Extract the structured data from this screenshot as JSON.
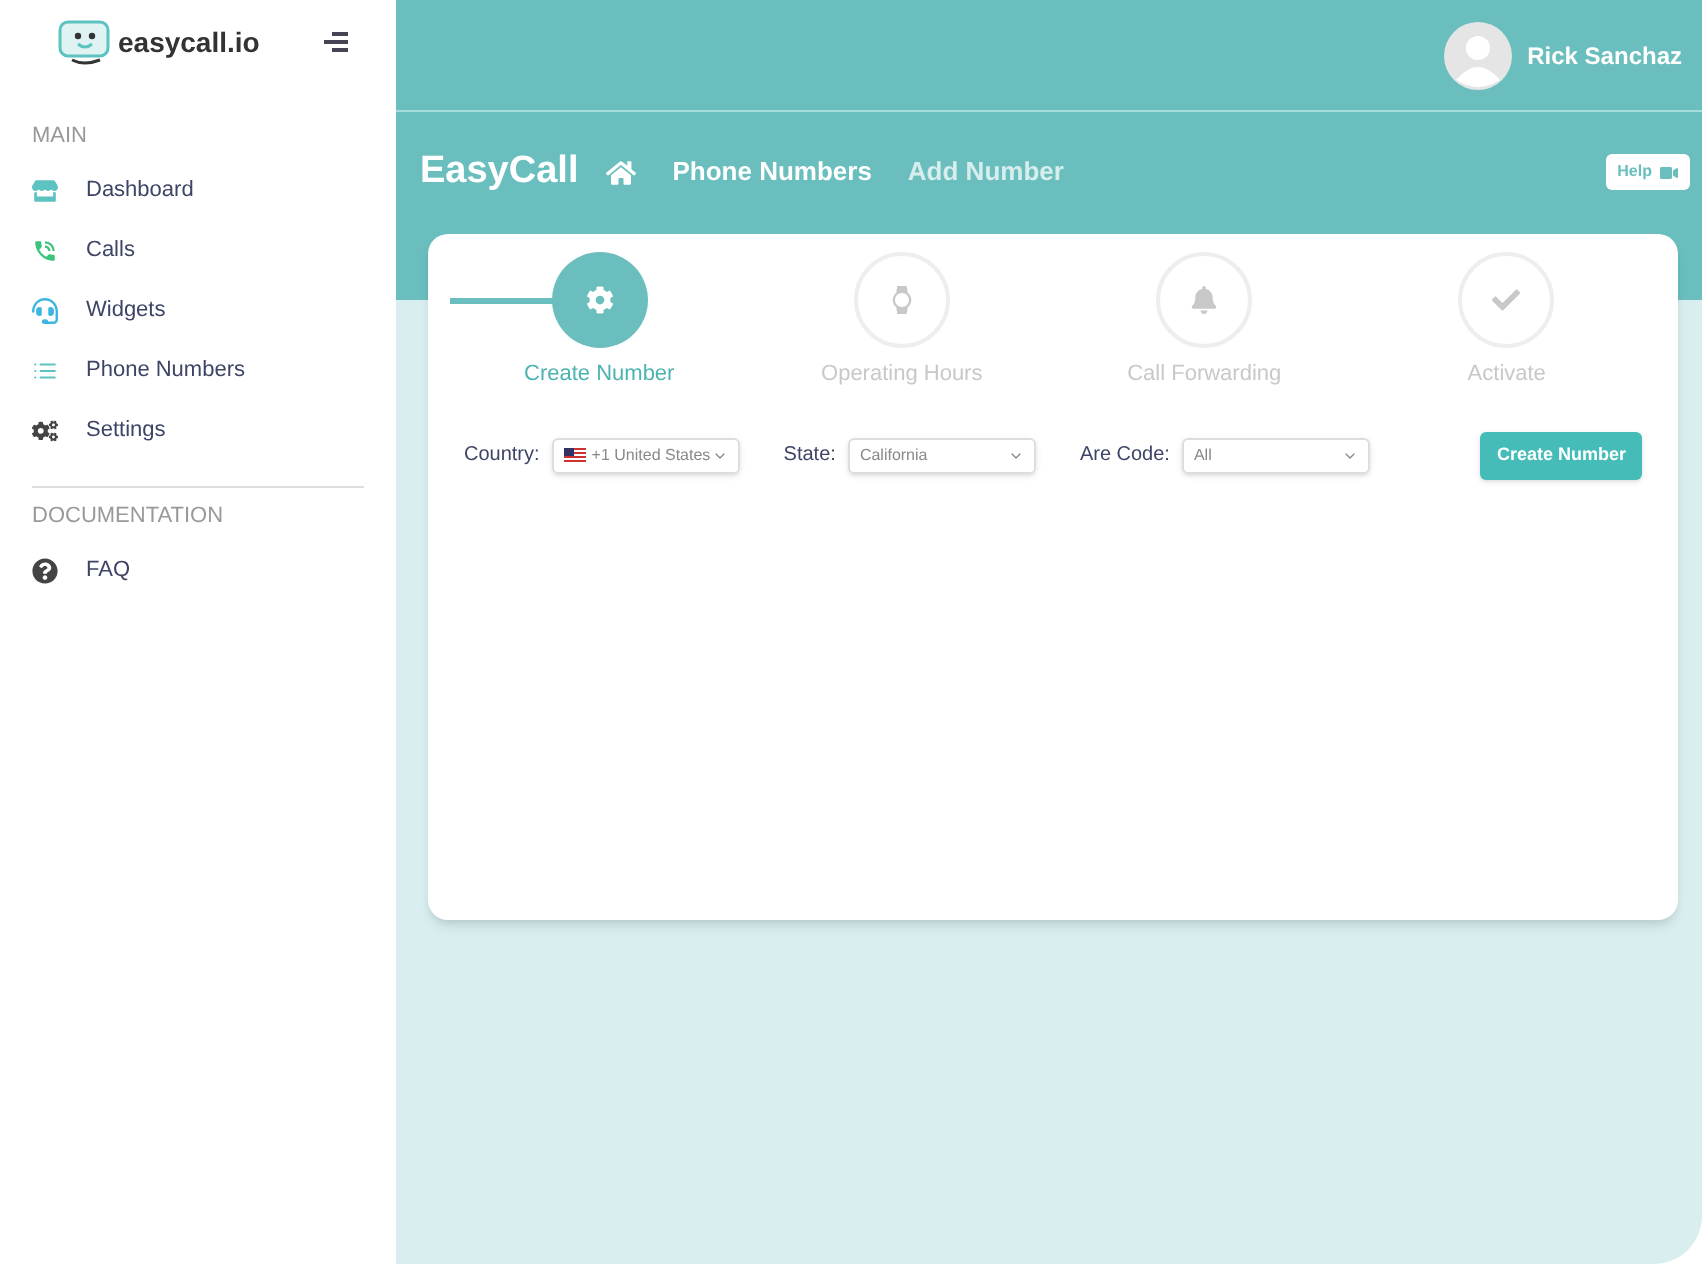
{
  "brand": {
    "name": "easycall.io"
  },
  "sidebar": {
    "sections": [
      {
        "title": "MAIN",
        "items": [
          {
            "label": "Dashboard"
          },
          {
            "label": "Calls"
          },
          {
            "label": "Widgets"
          },
          {
            "label": "Phone Numbers"
          },
          {
            "label": "Settings"
          }
        ]
      },
      {
        "title": "DOCUMENTATION",
        "items": [
          {
            "label": "FAQ"
          }
        ]
      }
    ]
  },
  "user": {
    "name": "Rick Sanchaz"
  },
  "breadcrumb": {
    "title": "EasyCall",
    "items": [
      {
        "label": "Phone Numbers",
        "selected": true
      },
      {
        "label": "Add Number",
        "selected": false
      }
    ]
  },
  "help_button": "Help",
  "steps": [
    {
      "label": "Create Number",
      "selected": true
    },
    {
      "label": "Operating Hours",
      "selected": false
    },
    {
      "label": "Call Forwarding",
      "selected": false
    },
    {
      "label": "Activate",
      "selected": false
    }
  ],
  "form": {
    "fields": [
      {
        "label": "Country:",
        "value": "+1 United States",
        "kind": "flag"
      },
      {
        "label": "State:",
        "value": "California",
        "kind": "plain"
      },
      {
        "label": "Are Code:",
        "value": "All",
        "kind": "plain"
      }
    ],
    "submit": "Create Number"
  }
}
